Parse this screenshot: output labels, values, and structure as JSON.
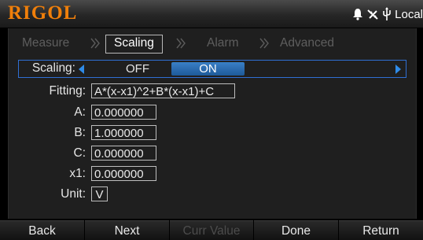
{
  "brand": "RIGOL",
  "status": {
    "local_label": "Local",
    "icons": [
      "bell-icon",
      "usb-disconnect-icon",
      "usb-icon"
    ]
  },
  "tabs": [
    {
      "label": "Measure",
      "active": false
    },
    {
      "label": "Scaling",
      "active": true
    },
    {
      "label": "Alarm",
      "active": false
    },
    {
      "label": "Advanced",
      "active": false
    }
  ],
  "form": {
    "scaling": {
      "label": "Scaling:",
      "options": [
        "OFF",
        "ON"
      ],
      "selected": "ON"
    },
    "fitting": {
      "label": "Fitting:",
      "value": "A*(x-x1)^2+B*(x-x1)+C"
    },
    "a": {
      "label": "A:",
      "value": "0.000000"
    },
    "b": {
      "label": "B:",
      "value": "1.000000"
    },
    "c": {
      "label": "C:",
      "value": "0.000000"
    },
    "x1": {
      "label": "x1:",
      "value": "0.000000"
    },
    "unit": {
      "label": "Unit:",
      "value": "V"
    }
  },
  "softkeys": [
    {
      "label": "Back",
      "enabled": true
    },
    {
      "label": "Next",
      "enabled": true
    },
    {
      "label": "Curr Value",
      "enabled": false
    },
    {
      "label": "Done",
      "enabled": true
    },
    {
      "label": "Return",
      "enabled": true
    }
  ],
  "colors": {
    "brand": "#f07f0a",
    "accent": "#2f8be8",
    "selection": "#2a6fb5"
  }
}
